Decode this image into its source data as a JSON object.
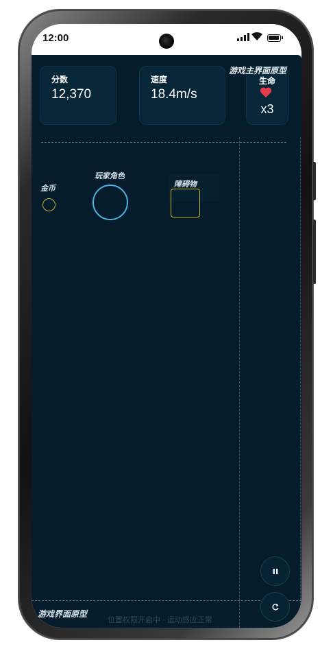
{
  "status_bar": {
    "time": "12:00"
  },
  "hud": {
    "score": {
      "label": "分数",
      "value": "12,370"
    },
    "speed": {
      "label": "速度",
      "value": "18.4m/s"
    },
    "lives": {
      "label": "生命",
      "value": "x3"
    },
    "prototype_title": "游戏主界面原型"
  },
  "playfield": {
    "coin_label": "金币",
    "player_label": "玩家角色",
    "obstacle_label": "障碍物"
  },
  "controls": {
    "pause_icon": "pause-icon",
    "restart_icon": "restart-icon"
  },
  "footer": {
    "title": "游戏界面原型",
    "status": "位置权限开启中 · 运动感应正常"
  },
  "colors": {
    "background": "#041c2b",
    "card": "#072638",
    "player": "#4fb3e2",
    "gold": "#c9b52a",
    "heart": "#e53e4a"
  }
}
